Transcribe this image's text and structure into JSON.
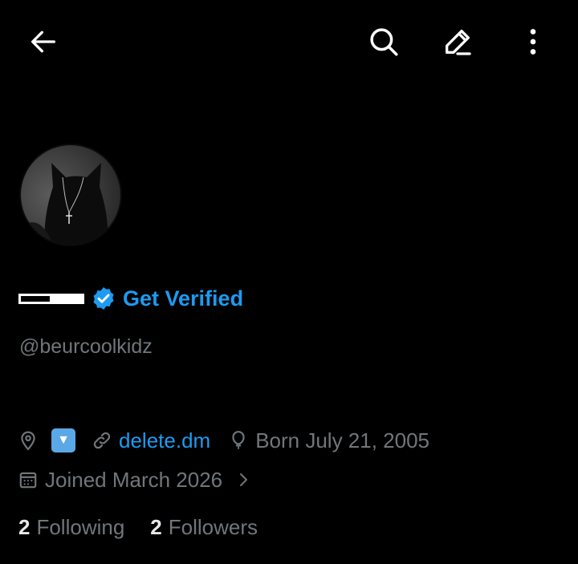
{
  "header": {
    "back_icon": "arrow-left-icon",
    "search_icon": "search-icon",
    "edit_icon": "pencil-icon",
    "more_icon": "more-vertical-icon"
  },
  "profile": {
    "avatar_icon": "cat-avatar",
    "verify_label": "Get Verified",
    "handle": "@beurcoolkidz"
  },
  "meta": {
    "location_emoji": "🔽",
    "link": "delete.dm",
    "born": "Born July 21, 2005",
    "joined": "Joined March 2026"
  },
  "stats": {
    "following_count": "2",
    "following_label": "Following",
    "followers_count": "2",
    "followers_label": "Followers"
  },
  "colors": {
    "accent": "#1d9bf0",
    "muted": "#71767b",
    "background": "#000000"
  }
}
